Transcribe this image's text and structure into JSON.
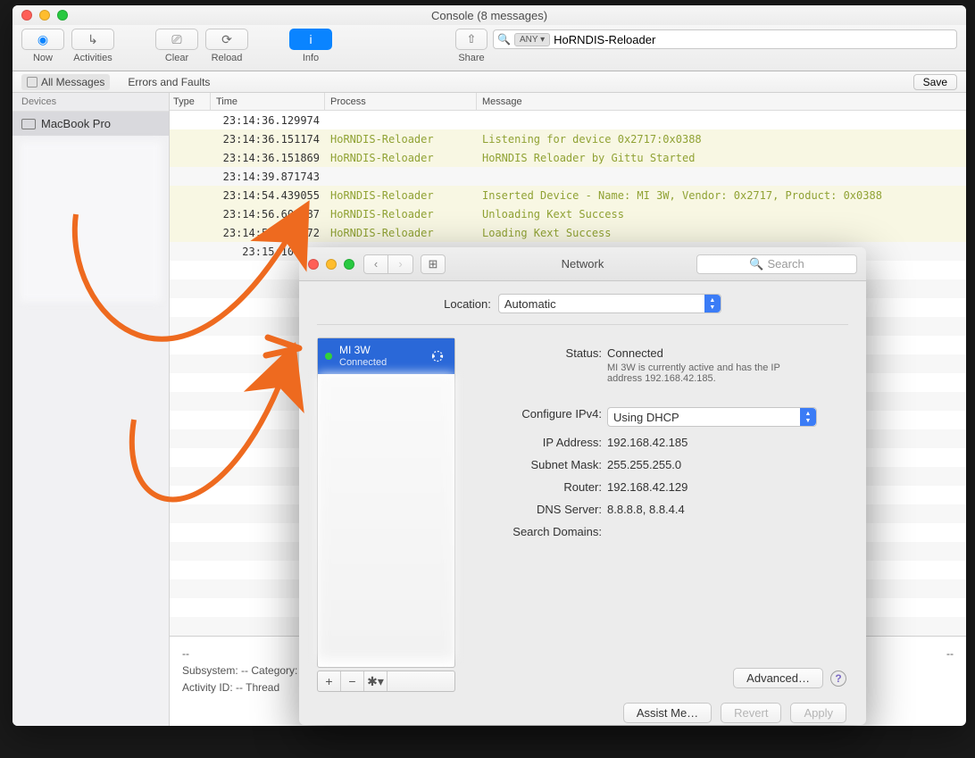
{
  "console": {
    "title": "Console (8 messages)",
    "toolbar": {
      "now": "Now",
      "activities": "Activities",
      "clear": "Clear",
      "reload": "Reload",
      "info": "Info",
      "share": "Share"
    },
    "search": {
      "chip": "ANY",
      "value": "HoRNDIS-Reloader"
    },
    "filters": {
      "all": "All Messages",
      "errors": "Errors and Faults",
      "save": "Save"
    },
    "sidebar": {
      "heading": "Devices",
      "item": "MacBook Pro"
    },
    "columns": {
      "type": "Type",
      "time": "Time",
      "process": "Process",
      "message": "Message"
    },
    "rows": [
      {
        "time": "23:14:36.129974",
        "process": "",
        "message": "",
        "hl": false
      },
      {
        "time": "23:14:36.151174",
        "process": "HoRNDIS-Reloader",
        "message": "Listening for device 0x2717:0x0388",
        "hl": true
      },
      {
        "time": "23:14:36.151869",
        "process": "HoRNDIS-Reloader",
        "message": "HoRNDIS Reloader by Gittu Started",
        "hl": true
      },
      {
        "time": "23:14:39.871743",
        "process": "",
        "message": "",
        "hl": false
      },
      {
        "time": "23:14:54.439055",
        "process": "HoRNDIS-Reloader",
        "message": "Inserted Device - Name: MI 3W, Vendor: 0x2717, Product: 0x0388",
        "hl": true
      },
      {
        "time": "23:14:56.601887",
        "process": "HoRNDIS-Reloader",
        "message": "Unloading Kext Success",
        "hl": true
      },
      {
        "time": "23:14:57.880772",
        "process": "HoRNDIS-Reloader",
        "message": "Loading Kext Success",
        "hl": true
      },
      {
        "time": "23:15:10.232",
        "process": "",
        "message": "",
        "hl": false
      }
    ],
    "detail": {
      "dashes": "--",
      "subsystem": "Subsystem: --  Category: --",
      "activity": "Activity ID: --  Thread",
      "rightdash": "--"
    }
  },
  "network": {
    "title": "Network",
    "search_placeholder": "Search",
    "location_label": "Location:",
    "location_value": "Automatic",
    "service": {
      "name": "MI 3W",
      "status": "Connected"
    },
    "fields": {
      "status_label": "Status:",
      "status_value": "Connected",
      "status_sub": "MI 3W is currently active and has the IP address 192.168.42.185.",
      "config_label": "Configure IPv4:",
      "config_value": "Using DHCP",
      "ip_label": "IP Address:",
      "ip_value": "192.168.42.185",
      "mask_label": "Subnet Mask:",
      "mask_value": "255.255.255.0",
      "router_label": "Router:",
      "router_value": "192.168.42.129",
      "dns_label": "DNS Server:",
      "dns_value": "8.8.8.8, 8.8.4.4",
      "domains_label": "Search Domains:",
      "domains_value": ""
    },
    "buttons": {
      "advanced": "Advanced…",
      "assist": "Assist Me…",
      "revert": "Revert",
      "apply": "Apply"
    }
  }
}
